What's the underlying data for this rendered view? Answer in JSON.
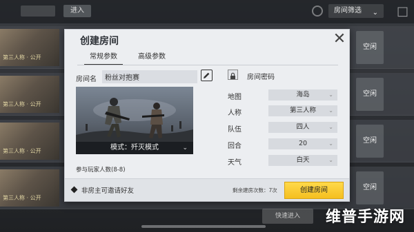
{
  "background": {
    "enter_label": "进入",
    "filter_label": "房间筛选",
    "row_caption": "第三人称 · 公开",
    "rows": [
      {
        "status": "空闲"
      },
      {
        "status": "空闲"
      },
      {
        "status": "空闲"
      },
      {
        "status": "空闲"
      }
    ],
    "bottom_button": "快速进入"
  },
  "dialog": {
    "title": "创建房间",
    "tabs": [
      {
        "label": "常规参数",
        "active": true
      },
      {
        "label": "高级参数",
        "active": false
      }
    ],
    "room_name_label": "房间名",
    "room_name_value": "粉丝对抱赛",
    "mode_label": "模式：歼灭模式",
    "player_count_label": "参与玩家人数(8-8)",
    "password_label": "房间密码",
    "options": [
      {
        "label": "地图",
        "value": "海岛"
      },
      {
        "label": "人称",
        "value": "第三人称"
      },
      {
        "label": "队伍",
        "value": "四人"
      },
      {
        "label": "回合",
        "value": "20"
      },
      {
        "label": "天气",
        "value": "白天"
      }
    ],
    "footer": {
      "note": "非房主可邀请好友",
      "remaining": "剩余建房次数：7次",
      "create_button": "创建房间"
    }
  },
  "watermark": "维普手游网",
  "colors": {
    "create_button": "#f5bf20",
    "dialog_bg": "#eceef1",
    "select_bg": "#d7dadf"
  }
}
